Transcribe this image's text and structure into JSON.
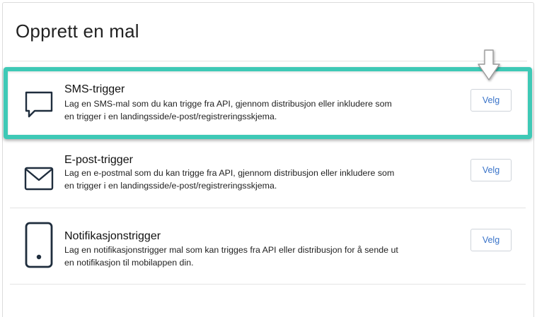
{
  "page": {
    "title": "Opprett en mal"
  },
  "templates": [
    {
      "icon": "chat-bubble-icon",
      "title": "SMS-trigger",
      "description": "Lag en SMS-mal som du kan trigge fra API, gjennom distribusjon eller inkludere som en trigger i en landingsside/e-post/registreringsskjema.",
      "button_label": "Velg"
    },
    {
      "icon": "envelope-icon",
      "title": "E-post-trigger",
      "description": "Lag en e-postmal som du kan trigge fra API, gjennom distribusjon eller inkludere som en trigger i en landingsside/e-post/registreringsskjema.",
      "button_label": "Velg"
    },
    {
      "icon": "mobile-phone-icon",
      "title": "Notifikasjonstrigger",
      "description": "Lag en notifikasjonstrigger mal som kan trigges fra API eller distribusjon for å sende ut en notifikasjon til mobilappen din.",
      "button_label": "Velg"
    }
  ],
  "annotation": {
    "highlight_color": "#3ec9b6",
    "highlighted_item": "SMS-trigger",
    "pointer_icon": "down-arrow-icon"
  },
  "colors": {
    "button_text": "#3a74c9",
    "icon_stroke": "#1f2d3d"
  }
}
